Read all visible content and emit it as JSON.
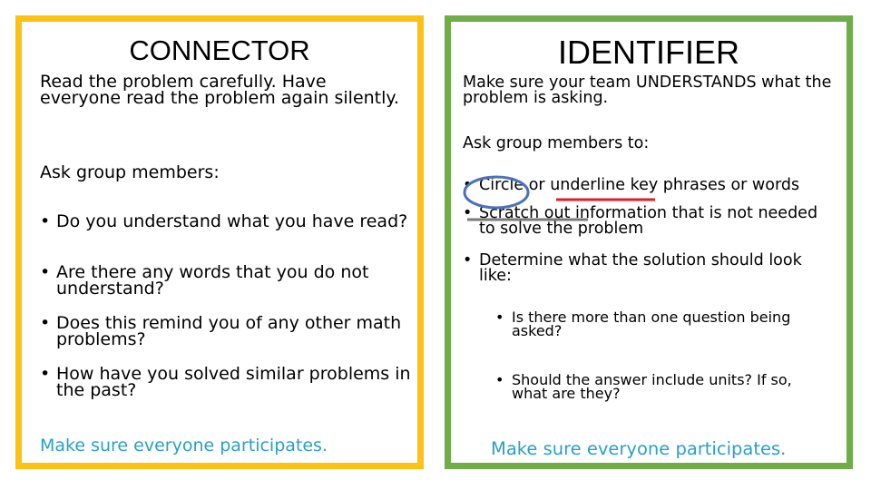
{
  "connector": {
    "title": "CONNECTOR",
    "intro": "Read the problem carefully. Have everyone read the problem again silently.",
    "ask_label": "Ask group members:",
    "bullets": [
      "Do you understand what you have read?",
      "Are there any words that you do not understand?",
      "Does this remind you of any other math problems?",
      "How have you solved similar problems in the past?"
    ],
    "footer": "Make sure everyone participates.",
    "border_color": "#fcc114"
  },
  "identifier": {
    "title": "IDENTIFIER",
    "intro": "Make sure your team UNDERSTANDS what the problem is asking.",
    "ask_label": "Ask group members to:",
    "bullet1": {
      "circled": "Circle",
      "mid": " or ",
      "underlined": "underline",
      "rest": " key phrases or words"
    },
    "bullet2": {
      "struck": "Scratch out",
      "rest": " information that is not needed to solve the problem"
    },
    "bullet3": "Determine what the solution should look like:",
    "sub_bullets": [
      "Is there more than one question being asked?",
      "Should the answer include units? If so, what are they?"
    ],
    "footer": "Make sure everyone participates.",
    "border_color": "#70ad47"
  },
  "bullet_glyph": "•",
  "accent_colors": {
    "footer_text": "#2aa0c8",
    "circle": "#4a72b8",
    "underline": "#d9202a",
    "strike": "#7a7a7a"
  }
}
